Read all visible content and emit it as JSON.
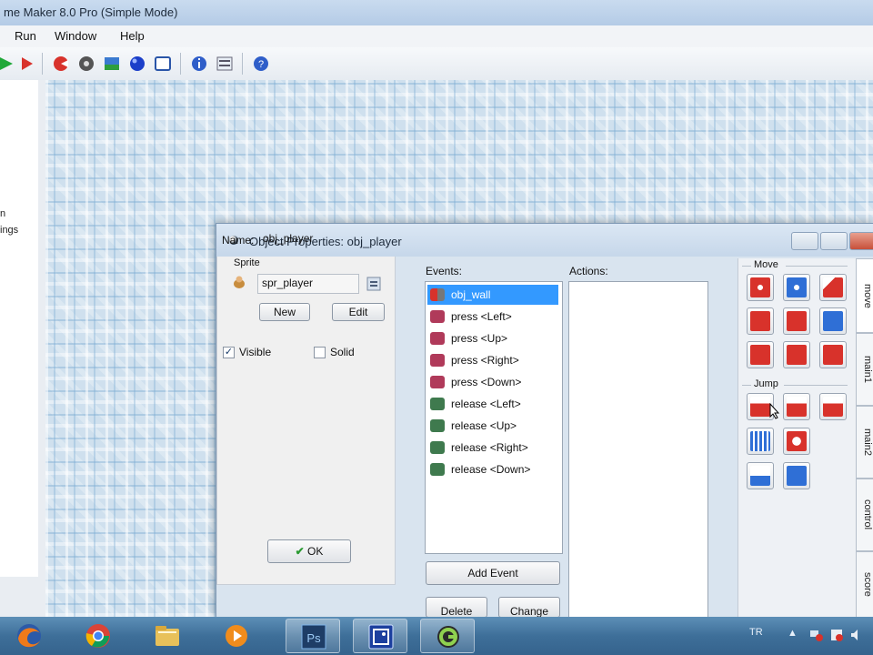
{
  "window": {
    "title": "me Maker 8.0 Pro (Simple Mode)"
  },
  "menu": [
    "Run",
    "Window",
    "Help"
  ],
  "tree": {
    "fragments": [
      "n",
      "ings"
    ]
  },
  "object_properties": {
    "title": "Object Properties: obj_player",
    "name_label": "Name:",
    "name_value": "obj_player",
    "sprite_group": "Sprite",
    "sprite_value": "spr_player",
    "new_button": "New",
    "edit_button": "Edit",
    "visible_label": "Visible",
    "visible_checked": true,
    "solid_label": "Solid",
    "solid_checked": false,
    "ok_button": "OK",
    "events_label": "Events:",
    "actions_label": "Actions:",
    "events": [
      {
        "label": "obj_wall",
        "icon": "collision-icon",
        "selected": true
      },
      {
        "label": "press <Left>",
        "icon": "key-press-icon"
      },
      {
        "label": "press <Up>",
        "icon": "key-press-icon"
      },
      {
        "label": "press <Right>",
        "icon": "key-press-icon"
      },
      {
        "label": "press <Down>",
        "icon": "key-press-icon"
      },
      {
        "label": "release <Left>",
        "icon": "key-release-icon"
      },
      {
        "label": "release <Up>",
        "icon": "key-release-icon"
      },
      {
        "label": "release <Right>",
        "icon": "key-release-icon"
      },
      {
        "label": "release <Down>",
        "icon": "key-release-icon"
      }
    ],
    "add_event_button": "Add Event",
    "delete_button": "Delete",
    "change_button": "Change",
    "move_group": "Move",
    "jump_group": "Jump",
    "tabs": [
      "move",
      "main1",
      "main2",
      "control",
      "score"
    ]
  },
  "taskbar": {
    "items": [
      "firefox-icon",
      "chrome-icon",
      "explorer-icon",
      "media-player-icon",
      "photoshop-icon",
      "game-maker-icon",
      "gm-logo-icon"
    ],
    "tray_lang": "TR"
  },
  "colors": {
    "selection": "#3399ff",
    "taskbar": "#3e6f99",
    "action_red": "#d8322b",
    "action_blue": "#2f6fd6"
  }
}
